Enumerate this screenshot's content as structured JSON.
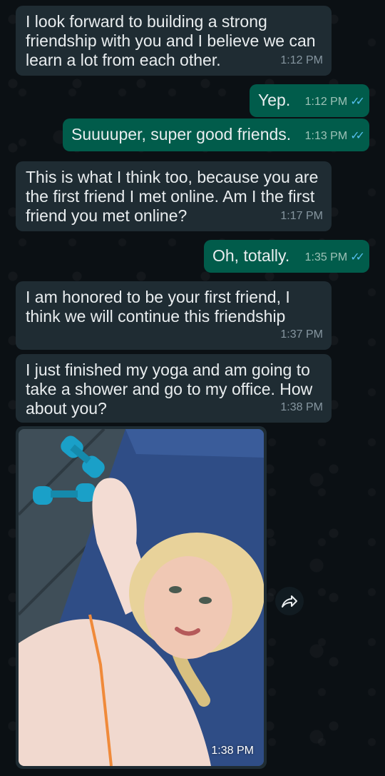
{
  "messages": [
    {
      "text": "I look forward to building a strong friendship with you and I believe we can learn a lot from each other.",
      "time": "1:12 PM"
    },
    {
      "text": "Yep.",
      "time": "1:12 PM"
    },
    {
      "text": "Suuuuper, super good friends.",
      "time": "1:13 PM"
    },
    {
      "text": "This is what I think too, because you are the first friend I met online. Am I the first friend you met online?",
      "time": "1:17 PM"
    },
    {
      "text": "Oh, totally.",
      "time": "1:35 PM"
    },
    {
      "text": "I am honored to be your first friend, I think we will continue this friendship",
      "time": "1:37 PM"
    },
    {
      "text": "I just finished my yoga and am going to take a shower and go to my office. How about you?",
      "time": "1:38 PM"
    }
  ],
  "photo_message": {
    "time": "1:38 PM",
    "alt": "selfie on yoga mat"
  },
  "read_ticks": "✓✓",
  "colors": {
    "incoming": "#1f2c33",
    "outgoing": "#015c4b",
    "background": "#0b1014",
    "ticks": "#53bdeb"
  },
  "icons": {
    "forward": "forward-icon"
  }
}
